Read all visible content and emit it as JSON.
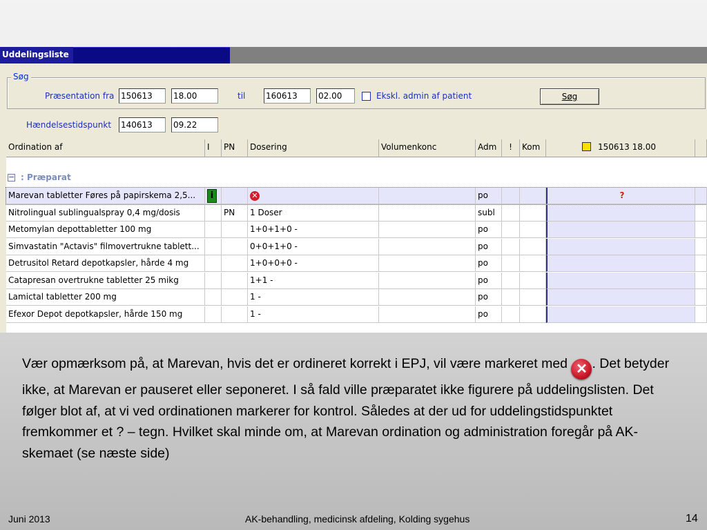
{
  "window": {
    "title": "Uddelingsliste"
  },
  "search": {
    "legend": "Søg",
    "presentation_from_label": "Præsentation fra",
    "from_date": "150613",
    "from_time": "18.00",
    "to_label": "til",
    "to_date": "160613",
    "to_time": "02.00",
    "exclude_admin_label": "Ekskl. admin af patient",
    "search_button": "Søg",
    "event_time_label": "Hændelsestidspunkt",
    "event_date": "140613",
    "event_time": "09.22"
  },
  "grid": {
    "headers": {
      "ordination": "Ordination af",
      "i": "I",
      "pn": "PN",
      "dosering": "Dosering",
      "volumenkonc": "Volumenkonc",
      "adm": "Adm",
      "excl": "!",
      "kom": "Kom",
      "slot": "150613 18.00"
    },
    "group_toggle": "−",
    "group_label": ": Præparat",
    "rows": [
      {
        "ordination": "Marevan tabletter Føres på papirskema 2,5...",
        "i": "i",
        "pn": "",
        "dosering": "✕",
        "adm": "po",
        "slot": "?"
      },
      {
        "ordination": "Nitrolingual sublingualspray 0,4 mg/dosis",
        "i": "",
        "pn": "PN",
        "dosering": "1 Doser",
        "adm": "subl",
        "slot": ""
      },
      {
        "ordination": "Metomylan depottabletter 100 mg",
        "i": "",
        "pn": "",
        "dosering": "1+0+1+0 -",
        "adm": "po",
        "slot": ""
      },
      {
        "ordination": "Simvastatin \"Actavis\" filmovertrukne tablett...",
        "i": "",
        "pn": "",
        "dosering": "0+0+1+0 -",
        "adm": "po",
        "slot": ""
      },
      {
        "ordination": "Detrusitol Retard depotkapsler, hårde 4 mg",
        "i": "",
        "pn": "",
        "dosering": "1+0+0+0 -",
        "adm": "po",
        "slot": ""
      },
      {
        "ordination": "Catapresan overtrukne tabletter 25 mikg",
        "i": "",
        "pn": "",
        "dosering": "1+1 -",
        "adm": "po",
        "slot": ""
      },
      {
        "ordination": "Lamictal tabletter 200 mg",
        "i": "",
        "pn": "",
        "dosering": "1 -",
        "adm": "po",
        "slot": ""
      },
      {
        "ordination": "Efexor Depot depotkapsler, hårde 150 mg",
        "i": "",
        "pn": "",
        "dosering": "1 -",
        "adm": "po",
        "slot": ""
      }
    ]
  },
  "caption": {
    "part1": "Vær opmærksom på, at Marevan, hvis det er ordineret korrekt i EPJ, vil være markeret med",
    "icon_glyph": "✕",
    "part2": ". Det betyder ikke, at Marevan er pauseret eller seponeret. I så fald ville præparatet ikke figurere på uddelingslisten. Det følger blot af, at vi ved ordinationen markerer for kontrol. Således at der ud for uddelingstidspunktet fremkommer et ? – tegn. Hvilket skal minde om, at Marevan ordination og administration foregår på AK-skemaet (se næste side)"
  },
  "footer": {
    "date": "Juni 2013",
    "center": "AK-behandling, medicinsk afdeling, Kolding sygehus",
    "page": "14"
  },
  "colors": {
    "title_bar": "#0a0a84",
    "selected_row": "#e6e6fa",
    "slot_warning": "#f5c842",
    "error_icon": "#d0202a",
    "label_blue": "#1c30b8"
  }
}
